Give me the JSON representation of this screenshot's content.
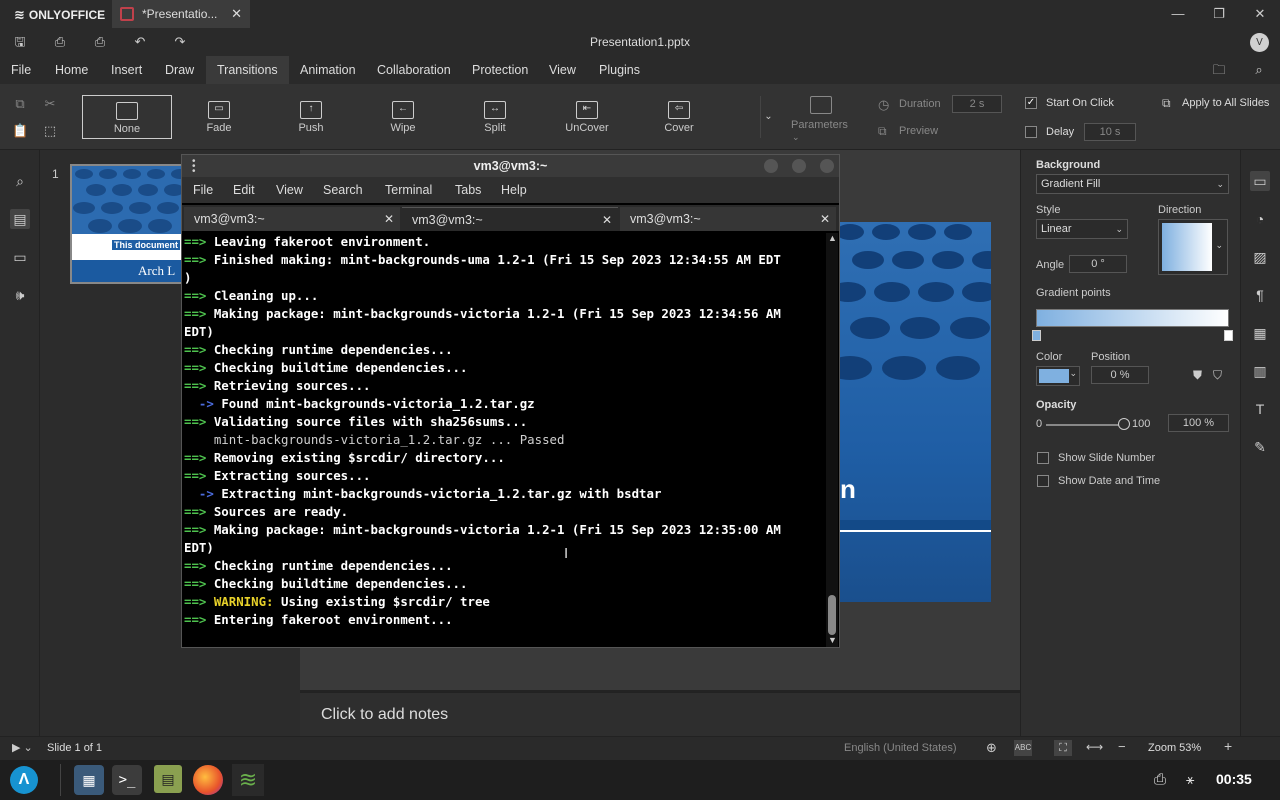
{
  "app": {
    "brand": "ONLYOFFICE",
    "doc_tab": "*Presentatio...",
    "doc_title": "Presentation1.pptx",
    "avatar": "V"
  },
  "menu_tabs": [
    "File",
    "Home",
    "Insert",
    "Draw",
    "Transitions",
    "Animation",
    "Collaboration",
    "Protection",
    "View",
    "Plugins"
  ],
  "transitions": [
    "None",
    "Fade",
    "Push",
    "Wipe",
    "Split",
    "UnCover",
    "Cover"
  ],
  "ribbon": {
    "parameters": "Parameters",
    "duration_label": "Duration",
    "duration_value": "2 s",
    "preview": "Preview",
    "start_on_click": "Start On Click",
    "delay_label": "Delay",
    "delay_value": "10 s",
    "apply_all": "Apply to All Slides"
  },
  "thumbnail": {
    "number": "1",
    "caption": "This document",
    "title": "Arch L"
  },
  "slide": {
    "fragment": "n"
  },
  "notes_placeholder": "Click to add notes",
  "right_panel": {
    "background_label": "Background",
    "background_value": "Gradient Fill",
    "style_label": "Style",
    "style_value": "Linear",
    "direction_label": "Direction",
    "angle_label": "Angle",
    "angle_value": "0 °",
    "gradient_points_label": "Gradient points",
    "color_label": "Color",
    "position_label": "Position",
    "position_value": "0 %",
    "opacity_label": "Opacity",
    "opacity_min": "0",
    "opacity_max": "100",
    "opacity_value": "100 %",
    "show_slide_number": "Show Slide Number",
    "show_date_time": "Show Date and Time",
    "accent_color": "#7fb0e0"
  },
  "status": {
    "slide_of": "Slide 1 of 1",
    "language": "English (United States)",
    "zoom": "Zoom 53%"
  },
  "taskbar": {
    "clock": "00:35"
  },
  "terminal": {
    "title": "vm3@vm3:~",
    "menu": [
      "File",
      "Edit",
      "View",
      "Search",
      "Terminal",
      "Tabs",
      "Help"
    ],
    "tabs": [
      "vm3@vm3:~",
      "vm3@vm3:~",
      "vm3@vm3:~"
    ],
    "lines": [
      {
        "p": "==> ",
        "t": "Leaving fakeroot environment.",
        "k": "b"
      },
      {
        "p": "==> ",
        "t": "Finished making: mint-backgrounds-uma 1.2-1 (Fri 15 Sep 2023 12:34:55 AM EDT",
        "k": "b"
      },
      {
        "p": "",
        "t": ")",
        "k": "b"
      },
      {
        "p": "==> ",
        "t": "Cleaning up...",
        "k": "b"
      },
      {
        "p": "==> ",
        "t": "Making package: mint-backgrounds-victoria 1.2-1 (Fri 15 Sep 2023 12:34:56 AM",
        "k": "b"
      },
      {
        "p": "",
        "t": "EDT)",
        "k": "b"
      },
      {
        "p": "==> ",
        "t": "Checking runtime dependencies...",
        "k": "b"
      },
      {
        "p": "==> ",
        "t": "Checking buildtime dependencies...",
        "k": "b"
      },
      {
        "p": "==> ",
        "t": "Retrieving sources...",
        "k": "b"
      },
      {
        "p": "  -> ",
        "t": "Found mint-backgrounds-victoria_1.2.tar.gz",
        "k": "a"
      },
      {
        "p": "==> ",
        "t": "Validating source files with sha256sums...",
        "k": "b"
      },
      {
        "p": "    ",
        "t": "mint-backgrounds-victoria_1.2.tar.gz ... Passed",
        "k": "n"
      },
      {
        "p": "==> ",
        "t": "Removing existing $srcdir/ directory...",
        "k": "b"
      },
      {
        "p": "==> ",
        "t": "Extracting sources...",
        "k": "b"
      },
      {
        "p": "  -> ",
        "t": "Extracting mint-backgrounds-victoria_1.2.tar.gz with bsdtar",
        "k": "a"
      },
      {
        "p": "==> ",
        "t": "Sources are ready.",
        "k": "b"
      },
      {
        "p": "==> ",
        "t": "Making package: mint-backgrounds-victoria 1.2-1 (Fri 15 Sep 2023 12:35:00 AM",
        "k": "b"
      },
      {
        "p": "",
        "t": "EDT)",
        "k": "b"
      },
      {
        "p": "==> ",
        "t": "Checking runtime dependencies...",
        "k": "b"
      },
      {
        "p": "==> ",
        "t": "Checking buildtime dependencies...",
        "k": "b"
      },
      {
        "p": "==> ",
        "w": "WARNING:",
        "t": " Using existing $srcdir/ tree",
        "k": "w"
      },
      {
        "p": "==> ",
        "t": "Entering fakeroot environment...",
        "k": "b"
      }
    ]
  }
}
